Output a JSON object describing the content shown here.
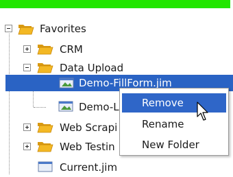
{
  "tree": {
    "root": {
      "label": "Favorites",
      "expanded": true
    },
    "items": [
      {
        "label": "CRM",
        "type": "folder",
        "expanded": false
      },
      {
        "label": "Data Upload",
        "type": "folder",
        "expanded": true
      },
      {
        "label": "Demo-FillForm.jim",
        "type": "file",
        "selected": true
      },
      {
        "label": "Demo-L",
        "type": "file",
        "selected": false
      },
      {
        "label": "Web Scrapi",
        "type": "folder",
        "expanded": false
      },
      {
        "label": "Web Testin",
        "type": "folder",
        "expanded": false
      },
      {
        "label": "Current.jim",
        "type": "file",
        "selected": false
      }
    ]
  },
  "context_menu": {
    "items": [
      {
        "label": "Remove",
        "highlighted": true
      },
      {
        "label": "Rename",
        "highlighted": false
      },
      {
        "label": "New Folder",
        "highlighted": false
      }
    ]
  },
  "colors": {
    "top_bar": "#22e600",
    "selection": "#2a63c4",
    "menu_highlight": "#2f66c8",
    "folder": "#f3b824"
  }
}
